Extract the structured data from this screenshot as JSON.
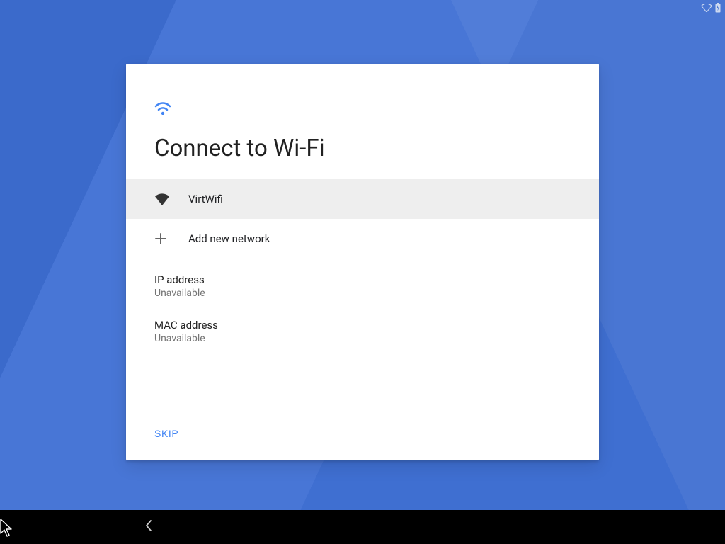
{
  "colors": {
    "accent": "#4285f4"
  },
  "status": {
    "wifi_icon": "wifi-outline",
    "battery_icon": "battery-charging"
  },
  "header": {
    "icon": "wifi",
    "title": "Connect to Wi-Fi"
  },
  "networks": [
    {
      "icon": "wifi-full",
      "label": "VirtWifi",
      "selected": true
    }
  ],
  "add_network": {
    "icon": "plus",
    "label": "Add new network"
  },
  "info": {
    "ip_label": "IP address",
    "ip_value": "Unavailable",
    "mac_label": "MAC address",
    "mac_value": "Unavailable"
  },
  "footer": {
    "skip_label": "SKIP"
  },
  "navbar": {
    "back_icon": "chevron-left"
  }
}
